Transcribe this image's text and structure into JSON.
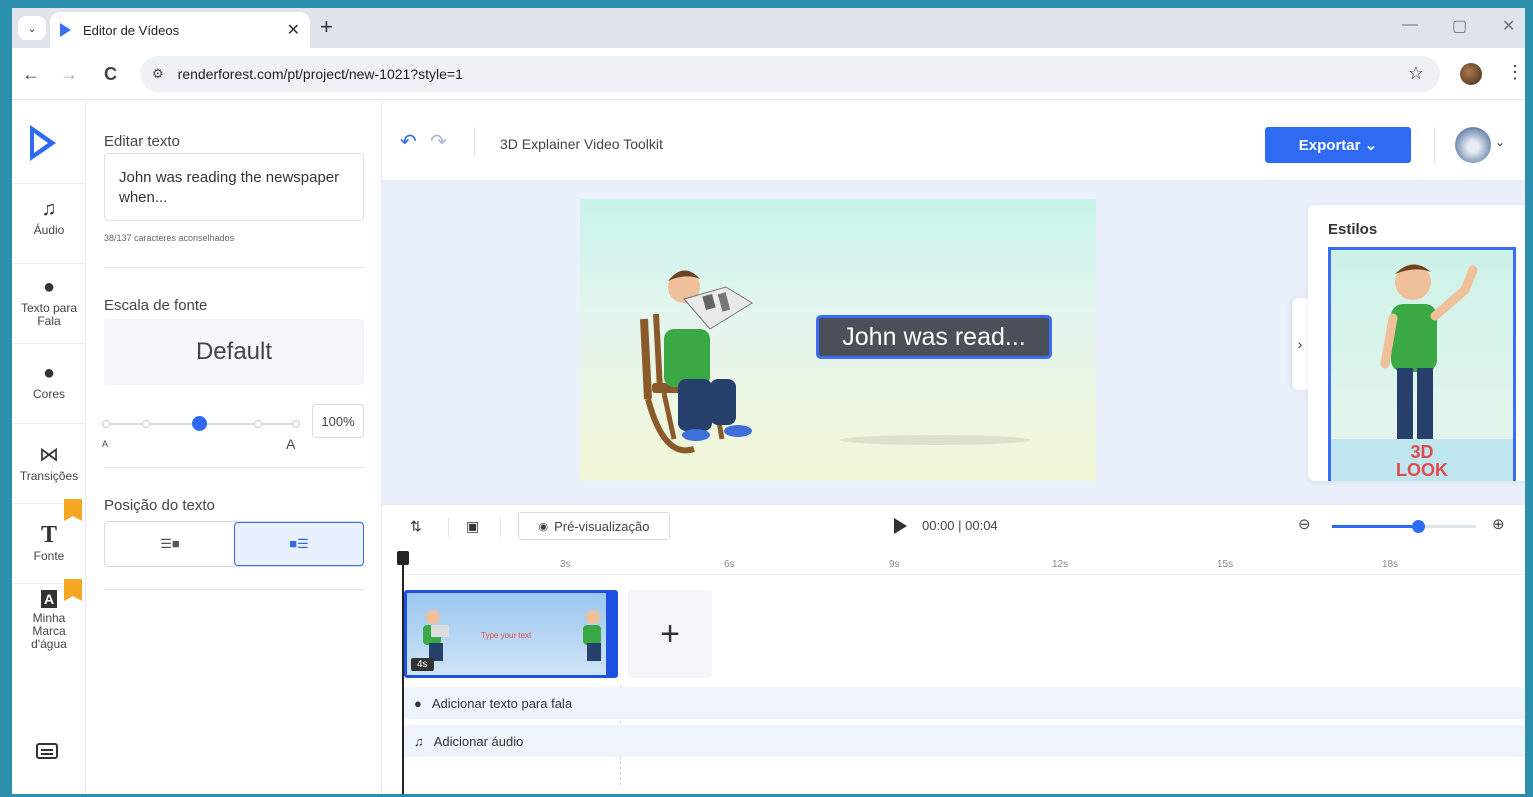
{
  "browser": {
    "tab_menu_icon": "chevron-down-icon",
    "tab_title": "Editor de Vídeos",
    "tab_close": "✕",
    "new_tab": "+",
    "url": "renderforest.com/pt/project/new-1021?style=1",
    "win_min": "—",
    "win_max": "▢",
    "win_close": "✕",
    "back": "←",
    "forward": "→",
    "reload": "C",
    "bookmark": "☆",
    "menu": "⋮"
  },
  "rail": {
    "items": [
      {
        "label": "Áudio",
        "icon": "music-note-icon",
        "glyph": "♫"
      },
      {
        "label": "Texto para Fala",
        "icon": "tts-bubble-icon",
        "glyph": "●"
      },
      {
        "label": "Cores",
        "icon": "palette-icon",
        "glyph": "●"
      },
      {
        "label": "Transições",
        "icon": "bowtie-icon",
        "glyph": "⋈"
      },
      {
        "label": "Fonte",
        "icon": "font-t-icon",
        "glyph": "T"
      },
      {
        "label": "Minha Marca d'água",
        "icon": "watermark-icon",
        "glyph": "A"
      }
    ]
  },
  "panel": {
    "edit_title": "Editar texto",
    "text_value": "John was reading the newspaper when...",
    "char_hint": "38/137  caracteres aconselhados",
    "scale_title": "Escala de fonte",
    "scale_value": "Default",
    "slider_small": "A",
    "slider_large": "A",
    "slider_level": 0.5,
    "percent": "100%",
    "position_title": "Posição do texto",
    "pos_left_glyph": "☰■",
    "pos_right_glyph": "■☰"
  },
  "header": {
    "project_title": "3D Explainer Video Toolkit",
    "export_label": "Exportar ⌄",
    "undo": "↶",
    "redo": "↷",
    "avatar_caret": "⌄"
  },
  "stage": {
    "caption": "John was read...",
    "styles_title": "Estilos",
    "style_thumb_label_line1": "3D",
    "style_thumb_label_line2": "LOOK",
    "collapse_glyph": "›"
  },
  "timeline": {
    "preview_label": "Pré-visualização",
    "time": "00:00 | 00:04",
    "zoom_out": "⊖",
    "zoom_in": "⊕",
    "zoom_level": 0.6,
    "ticks": [
      "3s",
      "6s",
      "9s",
      "12s",
      "15s",
      "18s"
    ],
    "clip_text": "Type your text",
    "clip_duration": "4s",
    "add_scene": "+",
    "tts_track": "Adicionar texto para fala",
    "audio_track": "Adicionar áudio"
  },
  "colors": {
    "accent": "#2f6bf2",
    "frame": "#2d8fae"
  }
}
